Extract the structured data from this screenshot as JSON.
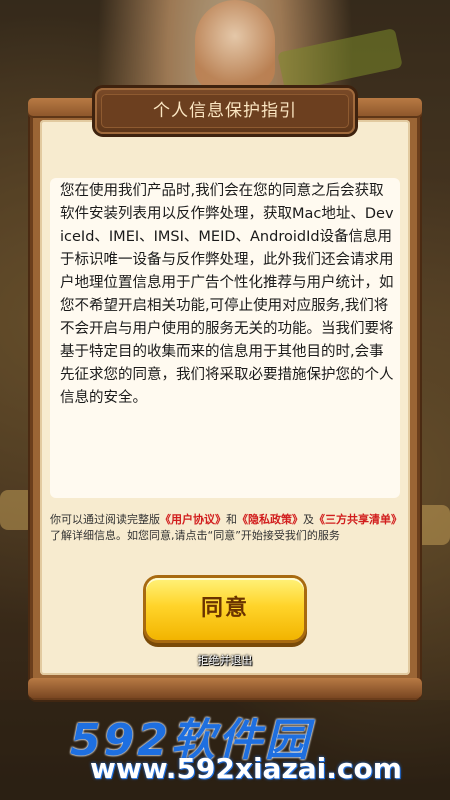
{
  "dialog": {
    "title": "个人信息保护指引",
    "body": "您在使用我们产品时,我们会在您的同意之后会获取软件安装列表用以反作弊处理，获取Mac地址、DeviceId、IMEI、IMSI、MEID、AndroidId设备信息用于标识唯一设备与反作弊处理，此外我们还会请求用户地理位置信息用于广告个性化推荐与用户统计，如您不希望开启相关功能,可停止使用对应服务,我们将不会开启与用户使用的服务无关的功能。当我们要将基于特定目的收集而来的信息用于其他目的时,会事先征求您的同意，我们将采取必要措施保护您的个人信息的安全。",
    "footer": {
      "prefix": "你可以通过阅读完整版",
      "user_agreement": "《用户协议》",
      "and": "和",
      "privacy_policy": "《隐私政策》",
      "also": "及",
      "third_party_list": "《三方共享清单》",
      "suffix": "了解详细信息。如您同意,请点击“同意”开始接受我们的服务"
    },
    "agree_label": "同意",
    "refuse_label": "拒绝并退出"
  },
  "watermark": {
    "main": "592软件园",
    "sub": "www.592xiazai.com"
  },
  "colors": {
    "link": "#d11d1d",
    "button": "#ffd42a",
    "frame": "#9b6535",
    "paper": "#f7ebcf",
    "watermark_blue": "#1e6fe0"
  }
}
